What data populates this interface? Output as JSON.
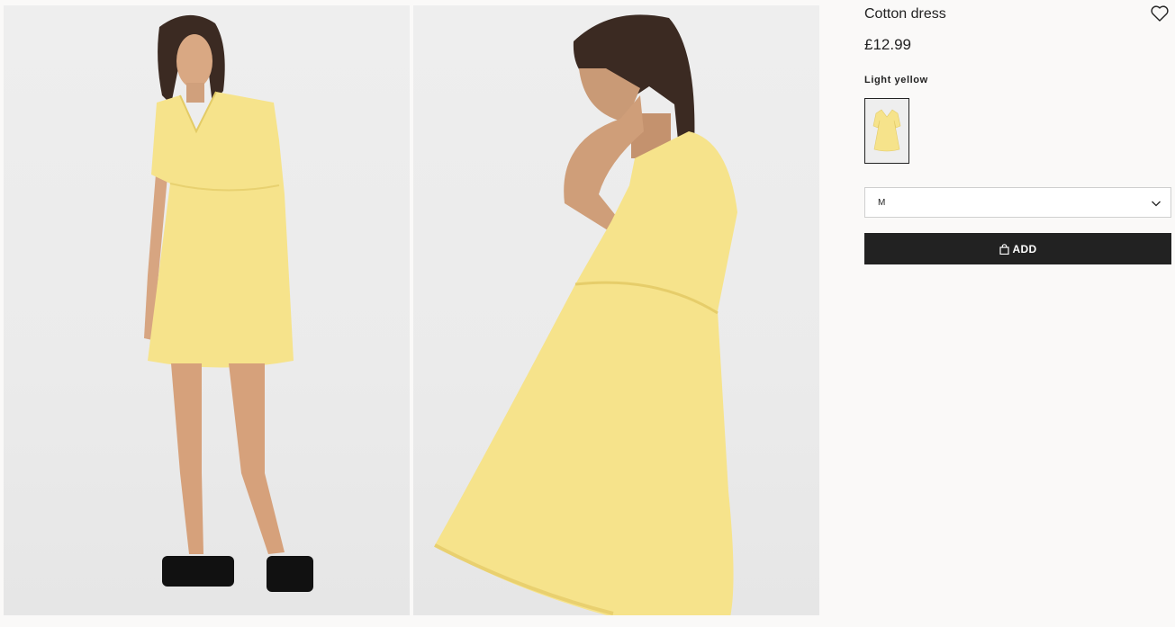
{
  "product": {
    "title": "Cotton dress",
    "price": "£12.99",
    "color_name": "Light yellow",
    "selected_size": "M",
    "add_label": "ADD"
  },
  "icons": {
    "favorite": "heart-outline-icon",
    "size_dropdown": "chevron-down-icon",
    "add": "shopping-bag-icon"
  },
  "colors": {
    "dress": "#f6e38b",
    "background": "#faf9f8",
    "button": "#222222",
    "photo_backdrop": "#ececec"
  }
}
